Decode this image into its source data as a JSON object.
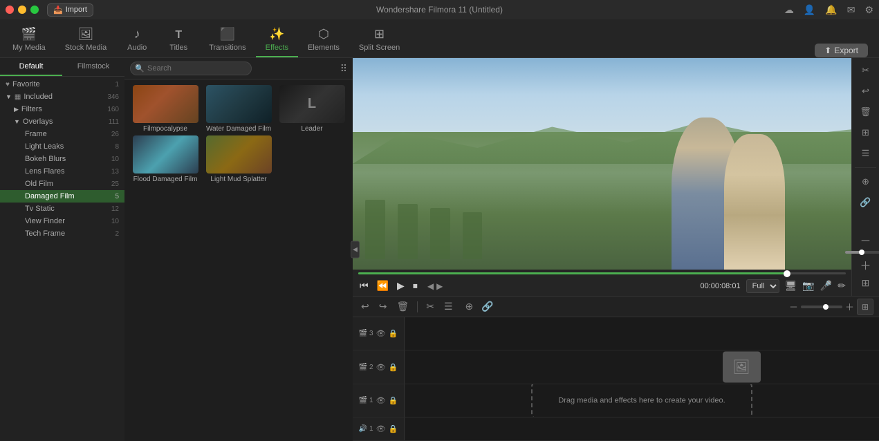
{
  "app": {
    "title": "Wondershare Filmora 11 (Untitled)"
  },
  "titlebar": {
    "import_label": "Import"
  },
  "nav": {
    "items": [
      {
        "id": "my-media",
        "label": "My Media",
        "icon": "🎬"
      },
      {
        "id": "stock-media",
        "label": "Stock Media",
        "icon": "🖼"
      },
      {
        "id": "audio",
        "label": "Audio",
        "icon": "🎵"
      },
      {
        "id": "titles",
        "label": "Titles",
        "icon": "T"
      },
      {
        "id": "transitions",
        "label": "Transitions",
        "icon": "⬛"
      },
      {
        "id": "effects",
        "label": "Effects",
        "icon": "✨",
        "active": true
      },
      {
        "id": "elements",
        "label": "Elements",
        "icon": "⬡"
      },
      {
        "id": "split-screen",
        "label": "Split Screen",
        "icon": "⊞"
      }
    ],
    "export_label": "Export"
  },
  "sidebar": {
    "tabs": [
      {
        "id": "default",
        "label": "Default",
        "active": true
      },
      {
        "id": "filmstock",
        "label": "Filmstock"
      }
    ],
    "search": {
      "placeholder": "Search"
    },
    "categories": [
      {
        "id": "favorite",
        "label": "Favorite",
        "icon": "♥",
        "count": "1",
        "indent": 0,
        "expandable": false
      },
      {
        "id": "included",
        "label": "Included",
        "icon": "▦",
        "count": "346",
        "indent": 0,
        "expandable": true,
        "expanded": true
      },
      {
        "id": "filters",
        "label": "Filters",
        "count": "160",
        "indent": 1,
        "expandable": true,
        "expanded": false
      },
      {
        "id": "overlays",
        "label": "Overlays",
        "count": "111",
        "indent": 0,
        "expandable": true,
        "expanded": true,
        "isChild": true
      },
      {
        "id": "frame",
        "label": "Frame",
        "count": "26",
        "indent": 2
      },
      {
        "id": "light-leaks",
        "label": "Light Leaks",
        "count": "8",
        "indent": 2
      },
      {
        "id": "bokeh-blurs",
        "label": "Bokeh Blurs",
        "count": "10",
        "indent": 2
      },
      {
        "id": "lens-flares",
        "label": "Lens Flares",
        "count": "13",
        "indent": 2
      },
      {
        "id": "old-film",
        "label": "Old Film",
        "count": "25",
        "indent": 2
      },
      {
        "id": "damaged-film",
        "label": "Damaged Film",
        "count": "5",
        "indent": 2,
        "active": true
      },
      {
        "id": "tv-static",
        "label": "Tv Static",
        "count": "12",
        "indent": 2
      },
      {
        "id": "view-finder",
        "label": "View Finder",
        "count": "10",
        "indent": 2
      },
      {
        "id": "tech-frame",
        "label": "Tech Frame",
        "count": "2",
        "indent": 2
      }
    ]
  },
  "effects": {
    "grid": [
      {
        "id": "filmpocalypse",
        "label": "Filmpocalypse",
        "thumb_class": "thumb-filmpocalypse"
      },
      {
        "id": "water-damaged",
        "label": "Water Damaged Film",
        "thumb_class": "thumb-water"
      },
      {
        "id": "leader",
        "label": "Leader",
        "thumb_class": "thumb-leader"
      },
      {
        "id": "flood-damaged",
        "label": "Flood Damaged Film",
        "thumb_class": "thumb-flood"
      },
      {
        "id": "light-mud",
        "label": "Light Mud Splatter",
        "thumb_class": "thumb-mudslatter"
      }
    ]
  },
  "preview": {
    "time_display": "00:00:08:01",
    "quality": "Full",
    "progress_pct": 88
  },
  "timeline": {
    "drop_zone_text": "Drag media and effects here to create your video.",
    "tracks": [
      {
        "num": "3",
        "has_clip": false
      },
      {
        "num": "2",
        "has_clip": false
      },
      {
        "num": "1",
        "has_clip": false
      },
      {
        "num": "1",
        "has_clip": false,
        "audio": true
      }
    ]
  }
}
